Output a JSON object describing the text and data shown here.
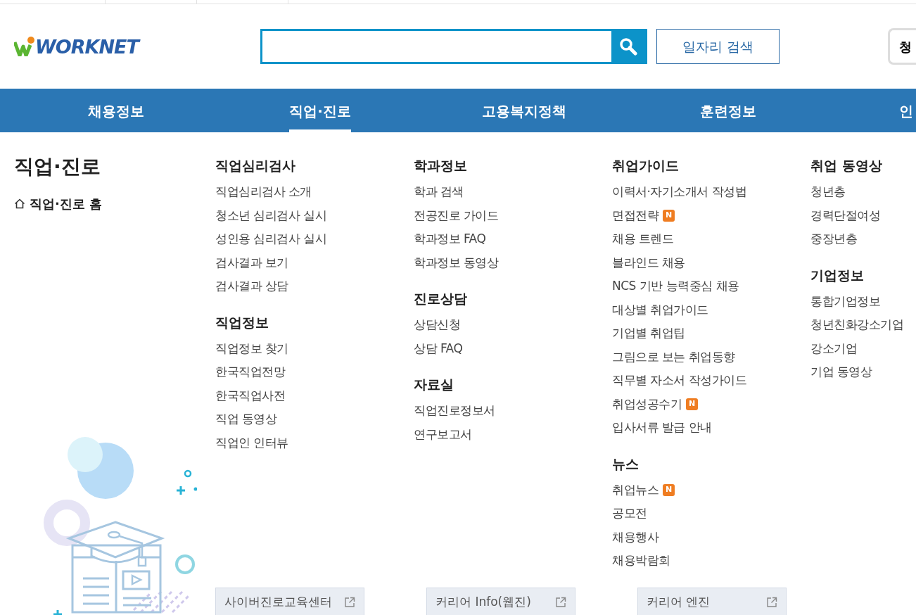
{
  "logo": {
    "text": "WORKNET"
  },
  "search": {
    "button": "일자리 검색",
    "side_button": "청"
  },
  "nav": [
    {
      "label": "채용정보",
      "selected": false
    },
    {
      "label": "직업·진로",
      "selected": true
    },
    {
      "label": "고용복지정책",
      "selected": false
    },
    {
      "label": "훈련정보",
      "selected": false
    },
    {
      "label": "인",
      "selected": false
    }
  ],
  "menu": {
    "title": "직업·진로",
    "home": "직업·진로 홈",
    "columns": [
      [
        {
          "heading": "직업심리검사",
          "items": [
            {
              "label": "직업심리검사 소개"
            },
            {
              "label": "청소년 심리검사 실시"
            },
            {
              "label": "성인용 심리검사 실시"
            },
            {
              "label": "검사결과 보기"
            },
            {
              "label": "검사결과 상담"
            }
          ]
        },
        {
          "heading": "직업정보",
          "items": [
            {
              "label": "직업정보 찾기"
            },
            {
              "label": "한국직업전망"
            },
            {
              "label": "한국직업사전"
            },
            {
              "label": "직업 동영상"
            },
            {
              "label": "직업인 인터뷰"
            }
          ]
        }
      ],
      [
        {
          "heading": "학과정보",
          "items": [
            {
              "label": "학과 검색"
            },
            {
              "label": "전공진로 가이드"
            },
            {
              "label": "학과정보 FAQ"
            },
            {
              "label": "학과정보 동영상"
            }
          ]
        },
        {
          "heading": "진로상담",
          "items": [
            {
              "label": "상담신청"
            },
            {
              "label": "상담 FAQ"
            }
          ]
        },
        {
          "heading": "자료실",
          "items": [
            {
              "label": "직업진로정보서"
            },
            {
              "label": "연구보고서"
            }
          ]
        }
      ],
      [
        {
          "heading": "취업가이드",
          "items": [
            {
              "label": "이력서·자기소개서 작성법"
            },
            {
              "label": "면접전략",
              "badge": "N"
            },
            {
              "label": "채용 트렌드"
            },
            {
              "label": "블라인드 채용"
            },
            {
              "label": "NCS 기반 능력중심 채용"
            },
            {
              "label": "대상별 취업가이드"
            },
            {
              "label": "기업별 취업팁"
            },
            {
              "label": "그림으로 보는 취업동향"
            },
            {
              "label": "직무별 자소서 작성가이드"
            },
            {
              "label": "취업성공수기",
              "badge": "N"
            },
            {
              "label": "입사서류 발급 안내"
            }
          ]
        },
        {
          "heading": "뉴스",
          "items": [
            {
              "label": "취업뉴스",
              "badge": "N"
            },
            {
              "label": "공모전"
            },
            {
              "label": "채용행사"
            },
            {
              "label": "채용박람회"
            }
          ]
        }
      ],
      [
        {
          "heading": "취업 동영상",
          "items": [
            {
              "label": "청년층"
            },
            {
              "label": "경력단절여성"
            },
            {
              "label": "중장년층"
            }
          ]
        },
        {
          "heading": "기업정보",
          "items": [
            {
              "label": "통합기업정보"
            },
            {
              "label": "청년친화강소기업"
            },
            {
              "label": "강소기업"
            },
            {
              "label": "기업 동영상"
            }
          ]
        }
      ]
    ]
  },
  "external_links": [
    "사이버진로교육센터",
    "커리어 Info(웹진)",
    "커리어 엔진"
  ]
}
